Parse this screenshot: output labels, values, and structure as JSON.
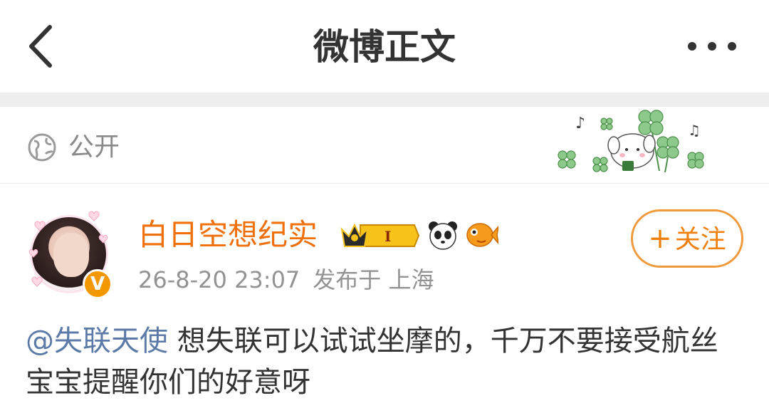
{
  "header": {
    "title": "微博正文",
    "back_icon": "chevron-left-icon",
    "more_icon": "more-dots-icon"
  },
  "visibility": {
    "icon": "globe-icon",
    "label": "公开"
  },
  "post": {
    "author": {
      "name": "白日空想纪实",
      "verified_badge": "V",
      "level_badge": "I"
    },
    "timestamp": "26-8-20 23:07",
    "location": "发布于 上海",
    "follow_label": "关注",
    "follow_plus": "+",
    "mention": "@失联天使",
    "body": " 想失联可以试试坐摩的，千万不要接受航丝宝宝提醒你们的好意呀"
  },
  "colors": {
    "accent_orange": "#f0700c",
    "mention_blue": "#5b7aa8",
    "meta_gray": "#939393"
  }
}
